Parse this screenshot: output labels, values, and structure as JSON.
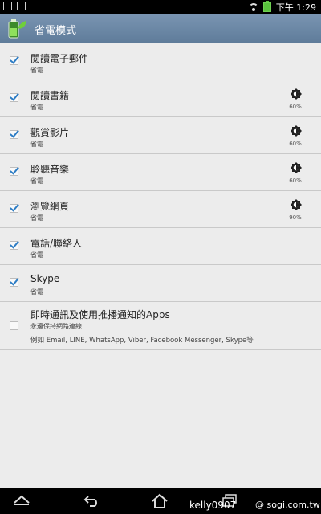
{
  "status": {
    "time": "下午 1:29"
  },
  "app": {
    "title": "省電模式"
  },
  "items": [
    {
      "title": "閱讀電子郵件",
      "subtitle": "省電",
      "checked": true
    },
    {
      "title": "閱讀書籍",
      "subtitle": "省電",
      "checked": true,
      "brightness": "60%"
    },
    {
      "title": "觀賞影片",
      "subtitle": "省電",
      "checked": true,
      "brightness": "60%"
    },
    {
      "title": "聆聽音樂",
      "subtitle": "省電",
      "checked": true,
      "brightness": "60%"
    },
    {
      "title": "瀏覽網頁",
      "subtitle": "省電",
      "checked": true,
      "brightness": "90%"
    },
    {
      "title": "電話/聯絡人",
      "subtitle": "省電",
      "checked": true
    },
    {
      "title": "Skype",
      "subtitle": "省電",
      "checked": true
    },
    {
      "title": "即時通訊及使用推播通知的Apps",
      "subtitle": "永遠保持網路連線",
      "note": "例如 Email, LINE, WhatsApp, Viber, Facebook Messenger, Skype等",
      "checked": false
    }
  ],
  "watermark": {
    "user": "kelly0907",
    "site": "@ sogi.com.tw"
  },
  "colors": {
    "actionbar": "#6b87a6",
    "check": "#2c7cc4",
    "divider": "#c9c9c9"
  }
}
